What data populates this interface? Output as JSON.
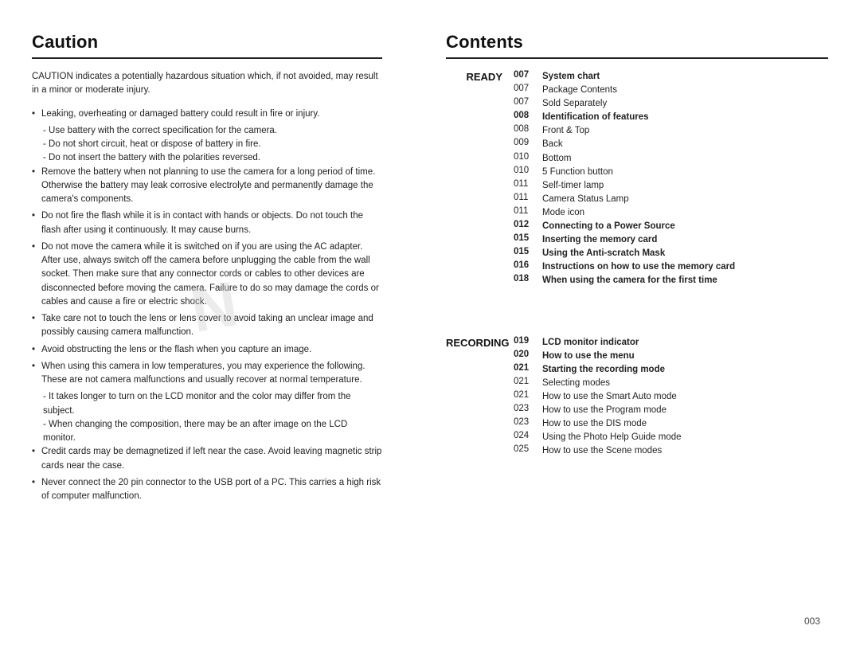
{
  "left": {
    "title": "Caution",
    "intro": "CAUTION indicates a potentially hazardous situation which, if not avoided, may result in a minor or moderate injury.",
    "bullets": [
      {
        "text": "Leaking, overheating or damaged battery could result in fire or injury.",
        "subs": [
          "- Use battery with the correct specification for the camera.",
          "- Do not short circuit, heat or dispose of battery in fire.",
          "- Do not insert the battery with the polarities reversed."
        ]
      },
      {
        "text": "Remove the battery when not planning to use the camera for a long period of time. Otherwise the battery may leak corrosive electrolyte and permanently damage the camera's components.",
        "subs": []
      },
      {
        "text": "Do not fire the flash while it is in contact with hands or objects. Do not touch the flash after using it continuously. It may cause burns.",
        "subs": []
      },
      {
        "text": "Do not move the camera while it is switched on if you are using the AC adapter. After use, always switch off the camera before unplugging the cable from the wall socket. Then make sure that any connector cords or cables to other devices are disconnected before moving the camera. Failure to do so may damage the cords or cables and cause a fire or electric shock.",
        "subs": []
      },
      {
        "text": "Take care not to touch the lens or lens cover to avoid taking an unclear image and possibly causing camera malfunction.",
        "subs": []
      },
      {
        "text": "Avoid obstructing the lens or the flash when you capture an image.",
        "subs": []
      },
      {
        "text": "When using this camera in low temperatures, you may experience the following. These are not camera malfunctions and usually recover at normal temperature.",
        "subs": [
          "- It takes longer to turn on the LCD monitor and the color may differ from the subject.",
          "- When changing the composition, there may be an after image on the LCD monitor."
        ]
      },
      {
        "text": "Credit cards may be demagnetized if left near the case. Avoid leaving magnetic strip cards near the case.",
        "subs": []
      },
      {
        "text": "Never connect the 20 pin connector to the USB port of a PC. This carries a high risk of computer malfunction.",
        "subs": []
      }
    ]
  },
  "right": {
    "title": "Contents",
    "ready_label": "READY",
    "ready_entries": [
      {
        "num": "007",
        "text": "System chart",
        "bold": true
      },
      {
        "num": "007",
        "text": "Package Contents",
        "bold": false
      },
      {
        "num": "007",
        "text": "Sold Separately",
        "bold": false
      },
      {
        "num": "008",
        "text": "Identification of features",
        "bold": true
      },
      {
        "num": "008",
        "text": "Front & Top",
        "bold": false
      },
      {
        "num": "009",
        "text": "Back",
        "bold": false
      },
      {
        "num": "010",
        "text": "Bottom",
        "bold": false
      },
      {
        "num": "010",
        "text": "5 Function button",
        "bold": false
      },
      {
        "num": "011",
        "text": "Self-timer lamp",
        "bold": false
      },
      {
        "num": "011",
        "text": "Camera Status Lamp",
        "bold": false
      },
      {
        "num": "011",
        "text": "Mode icon",
        "bold": false
      },
      {
        "num": "012",
        "text": "Connecting to a Power Source",
        "bold": true
      },
      {
        "num": "015",
        "text": "Inserting the memory card",
        "bold": true
      },
      {
        "num": "015",
        "text": "Using the Anti-scratch Mask",
        "bold": true
      },
      {
        "num": "016",
        "text": "Instructions on how to use the memory card",
        "bold": true
      },
      {
        "num": "018",
        "text": "When using the camera for the first time",
        "bold": true
      }
    ],
    "recording_label": "RECORDING",
    "recording_entries": [
      {
        "num": "019",
        "text": "LCD monitor indicator",
        "bold": true
      },
      {
        "num": "020",
        "text": "How to use the menu",
        "bold": true
      },
      {
        "num": "021",
        "text": "Starting the recording mode",
        "bold": true
      },
      {
        "num": "021",
        "text": "Selecting modes",
        "bold": false
      },
      {
        "num": "021",
        "text": "How to use the Smart Auto mode",
        "bold": false
      },
      {
        "num": "023",
        "text": "How to use the Program mode",
        "bold": false
      },
      {
        "num": "023",
        "text": "How to use the DIS mode",
        "bold": false
      },
      {
        "num": "024",
        "text": "Using the Photo Help Guide mode",
        "bold": false
      },
      {
        "num": "025",
        "text": "How to use the Scene modes",
        "bold": false
      }
    ],
    "page_num": "003"
  },
  "watermark": "N"
}
